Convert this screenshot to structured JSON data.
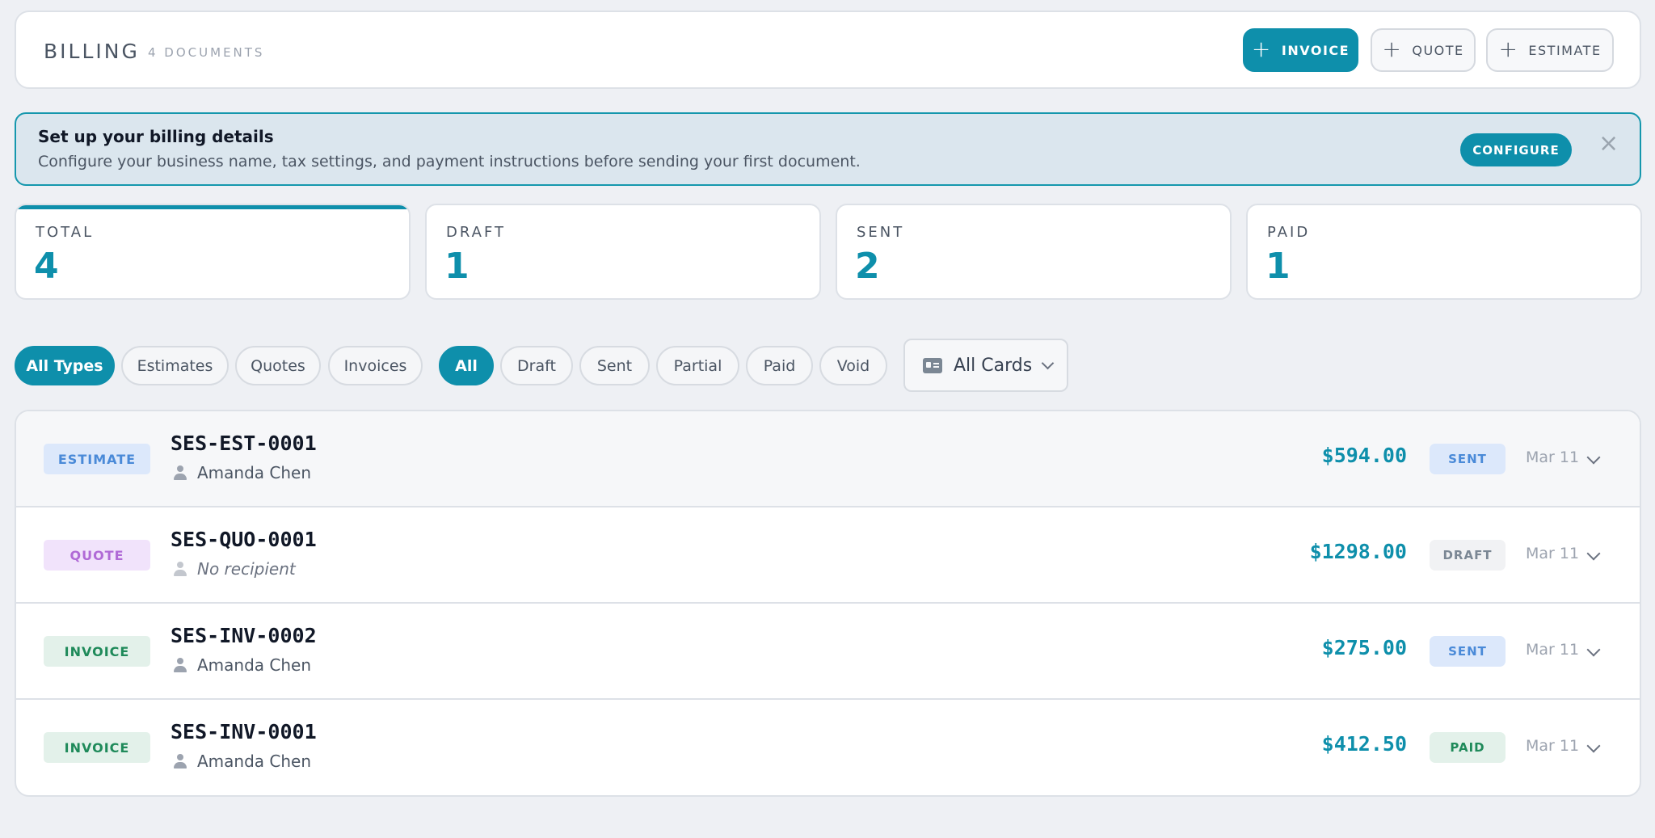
{
  "header": {
    "title": "BILLING",
    "count": "4 DOCUMENTS",
    "buttons": [
      {
        "label": "INVOICE"
      },
      {
        "label": "QUOTE"
      },
      {
        "label": "ESTIMATE"
      }
    ]
  },
  "banner": {
    "title": "Set up your billing details",
    "text": "Configure your business name, tax settings, and payment instructions before sending your first document.",
    "button": "CONFIGURE",
    "close": "×"
  },
  "stats": [
    {
      "label": "TOTAL",
      "value": "4"
    },
    {
      "label": "DRAFT",
      "value": "1"
    },
    {
      "label": "SENT",
      "value": "2"
    },
    {
      "label": "PAID",
      "value": "1"
    }
  ],
  "type_filters": [
    "All Types",
    "Estimates",
    "Quotes",
    "Invoices"
  ],
  "status_filters": [
    "All",
    "Draft",
    "Sent",
    "Partial",
    "Paid",
    "Void"
  ],
  "cards_select": {
    "value": "All Cards"
  },
  "documents": [
    {
      "type": "ESTIMATE",
      "id": "SES-EST-0001",
      "recipient": "Amanda Chen",
      "amount": "$594.00",
      "status": "SENT",
      "date": "Mar 11"
    },
    {
      "type": "QUOTE",
      "id": "SES-QUO-0001",
      "recipient": "No recipient",
      "amount": "$1298.00",
      "status": "DRAFT",
      "date": "Mar 11"
    },
    {
      "type": "INVOICE",
      "id": "SES-INV-0002",
      "recipient": "Amanda Chen",
      "amount": "$275.00",
      "status": "SENT",
      "date": "Mar 11"
    },
    {
      "type": "INVOICE",
      "id": "SES-INV-0001",
      "recipient": "Amanda Chen",
      "amount": "$412.50",
      "status": "PAID",
      "date": "Mar 11"
    }
  ],
  "colors": {
    "accent": "#0e8fab",
    "estimate_badge_bg": "#dce8fb",
    "estimate_badge_text": "#4a8ad8",
    "quote_badge_bg": "#f1e3fb",
    "quote_badge_text": "#b06ad6",
    "invoice_badge_bg": "#e3f1ea",
    "invoice_badge_text": "#1f8a5a",
    "sent_badge_bg": "#dce8fb",
    "sent_badge_text": "#4a8ad8",
    "draft_badge_bg": "#f1f2f4",
    "draft_badge_text": "#7b8794",
    "paid_badge_bg": "#e3f1ea",
    "paid_badge_text": "#1f8a5a"
  }
}
